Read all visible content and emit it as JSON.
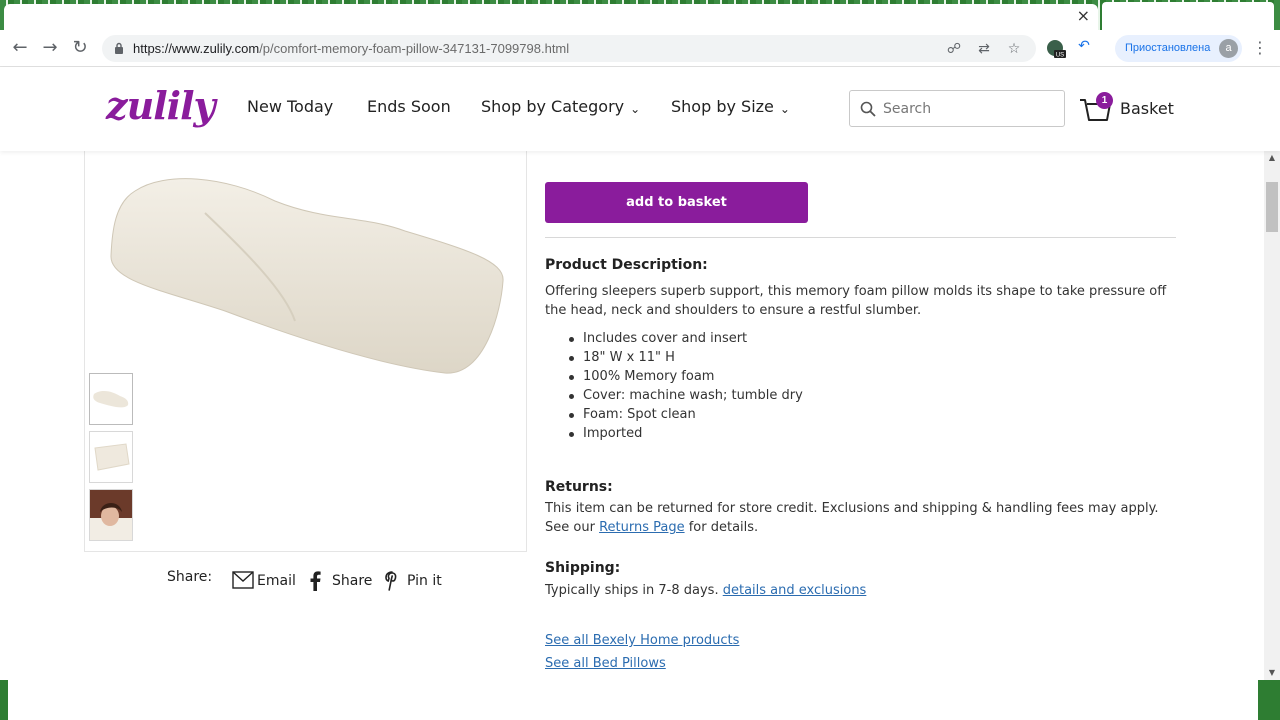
{
  "browser": {
    "tab_close": "×",
    "url_host": "https://www.zulily.com",
    "url_path": "/p/comfort-memory-foam-pillow-347131-7099798.html",
    "paused_label": "Приостановлена",
    "avatar_letter": "a",
    "ext_badge": "US"
  },
  "header": {
    "logo": "zulily",
    "nav": [
      "New Today",
      "Ends Soon",
      "Shop by Category",
      "Shop by Size"
    ],
    "search_placeholder": "Search",
    "basket_count": "1",
    "basket_label": "Basket"
  },
  "product": {
    "add_button": "add to basket",
    "description_title": "Product Description:",
    "description": "Offering sleepers superb support, this memory foam pillow molds its shape to take pressure off the head, neck and shoulders to ensure a restful slumber.",
    "bullets": [
      "Includes cover and insert",
      "18\" W x 11\" H",
      "100% Memory foam",
      "Cover: machine wash; tumble dry",
      "Foam: Spot clean",
      "Imported"
    ],
    "returns_title": "Returns:",
    "returns_text_1": "This item can be returned for store credit. Exclusions and shipping & handling fees may apply. See our ",
    "returns_link": "Returns Page",
    "returns_text_2": " for details.",
    "shipping_title": "Shipping:",
    "shipping_text": "Typically ships in 7-8 days. ",
    "shipping_link": "details and exclusions",
    "see_all_brand": "See all Bexely Home products",
    "see_all_category": "See all Bed Pillows"
  },
  "share": {
    "label": "Share:",
    "email": "Email",
    "facebook": "Share",
    "pinterest": "Pin it"
  },
  "colors": {
    "brand": "#8a1c9c",
    "link": "#2b6cb0"
  }
}
